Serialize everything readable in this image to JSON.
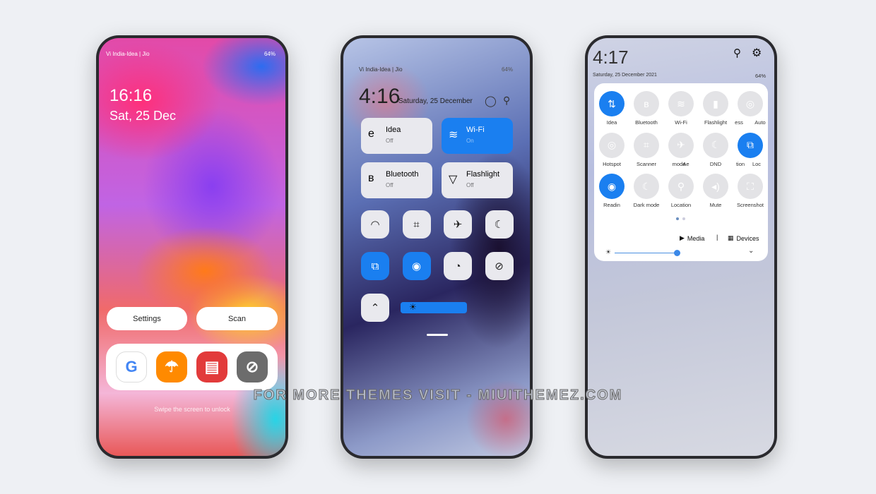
{
  "lockscreen": {
    "carrier": "Vi India-Idea | Jio",
    "battery": "64%",
    "time": "16:16",
    "date": "Sat, 25 Dec",
    "shortcuts": [
      "Settings",
      "Scan"
    ],
    "dock": [
      {
        "icon": "google-icon",
        "glyph": "G",
        "color": "#ffffff"
      },
      {
        "icon": "umbrella-icon",
        "glyph": "☂",
        "color": "#ff8a00"
      },
      {
        "icon": "notes-icon",
        "glyph": "▤",
        "color": "#e23b3b"
      },
      {
        "icon": "compass-icon",
        "glyph": "⊘",
        "color": "#6c6c6c"
      }
    ],
    "hint": "Swipe the screen to unlock"
  },
  "control_center": {
    "carrier": "Vi India-Idea | Jio",
    "battery": "64%",
    "time": "4:16",
    "date": "Saturday, 25 December",
    "tiles": [
      {
        "label": "Idea",
        "status": "Off",
        "icon": "mobile-data-icon",
        "glyph": "e",
        "on": false
      },
      {
        "label": "Wi-Fi",
        "status": "On",
        "icon": "wifi-icon",
        "glyph": "≋",
        "on": true
      },
      {
        "label": "Bluetooth",
        "status": "Off",
        "icon": "bluetooth-icon",
        "glyph": "ʙ",
        "on": false
      },
      {
        "label": "Flashlight",
        "status": "Off",
        "icon": "flashlight-icon",
        "glyph": "▽",
        "on": false
      }
    ],
    "toggles": [
      {
        "icon": "hotspot-icon",
        "glyph": "◠",
        "on": false
      },
      {
        "icon": "scanner-icon",
        "glyph": "⌗",
        "on": false
      },
      {
        "icon": "airplane-icon",
        "glyph": "✈",
        "on": false
      },
      {
        "icon": "dnd-moon-icon",
        "glyph": "☾",
        "on": false
      },
      {
        "icon": "auto-rotate-icon",
        "glyph": "⧉",
        "on": true
      },
      {
        "icon": "reading-mode-icon",
        "glyph": "◉",
        "on": true
      },
      {
        "icon": "battery-saver-icon",
        "glyph": "◔",
        "on": false
      },
      {
        "icon": "do-not-disturb-icon",
        "glyph": "⊘",
        "on": false
      },
      {
        "icon": "expand-icon",
        "glyph": "⌃",
        "on": false
      }
    ],
    "brightness": 0.95
  },
  "notification_shade": {
    "time": "4:17",
    "date": "Saturday, 25 December 2021",
    "battery": "64%",
    "toggles": [
      {
        "label": "Idea",
        "glyph": "⇅",
        "on": true
      },
      {
        "label": "Bluetooth",
        "glyph": "ʙ",
        "on": false
      },
      {
        "label": "Wi-Fi",
        "glyph": "≋",
        "on": false
      },
      {
        "label": "Flashlight",
        "glyph": "▮",
        "on": false
      },
      {
        "label": "ess",
        "glyph": "◎",
        "on": false
      },
      {
        "label": "Auto",
        "glyph": "◎",
        "on": false
      },
      {
        "label": "Hotspot",
        "glyph": "◎",
        "on": false
      },
      {
        "label": "Scanner",
        "glyph": "⌗",
        "on": false
      },
      {
        "label": "mode",
        "glyph": "✈",
        "on": false
      },
      {
        "label": "Ae",
        "glyph": "",
        "on": false
      },
      {
        "label": "DND",
        "glyph": "☾",
        "on": false
      },
      {
        "label": "tion",
        "glyph": "",
        "on": false
      },
      {
        "label": "Loc",
        "glyph": "⧉",
        "on": true
      },
      {
        "label": "Readin",
        "glyph": "◉",
        "on": true
      },
      {
        "label": "Dark mode",
        "glyph": "☾",
        "on": false
      },
      {
        "label": "Location",
        "glyph": "⚲",
        "on": false
      },
      {
        "label": "Mute",
        "glyph": "◂)",
        "on": false
      },
      {
        "label": "Screenshot",
        "glyph": "⛶",
        "on": false
      }
    ],
    "media": "Media",
    "devices": "Devices",
    "brightness": 0.6,
    "page": 1,
    "pages": 2
  },
  "watermark": "FOR MORE THEMES VISIT - MIUITHEMEZ.COM",
  "colors": {
    "accent": "#1a7ff0",
    "background": "#eef0f4"
  }
}
